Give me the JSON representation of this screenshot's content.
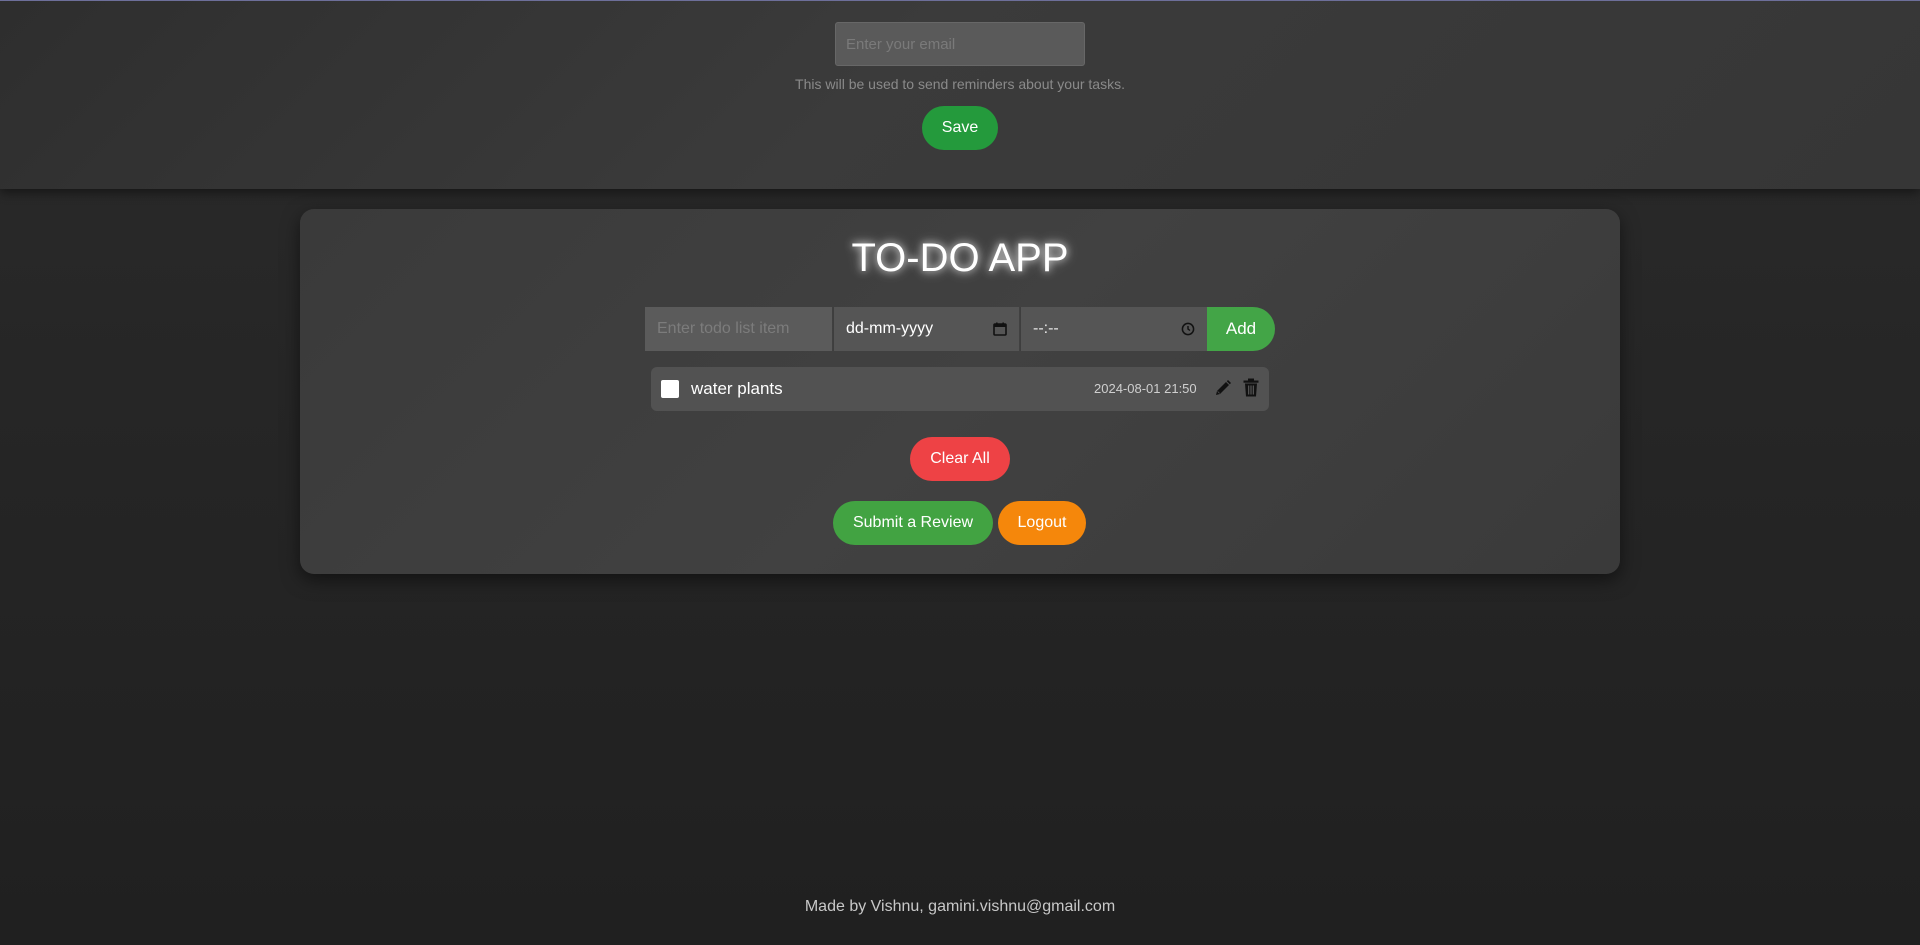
{
  "email_section": {
    "placeholder": "Enter your email",
    "hint": "This will be used to send reminders about your tasks.",
    "save_label": "Save"
  },
  "app": {
    "title": "TO-DO APP",
    "todo_placeholder": "Enter todo list item",
    "date_value": "dd-mm-yyyy",
    "time_value": "--:--",
    "add_label": "Add",
    "calendar_icon": "calendar-icon",
    "clock_icon": "clock-icon"
  },
  "todos": [
    {
      "text": "water plants",
      "datetime": "2024-08-01 21:50",
      "done": false,
      "edit_icon": "pencil-icon",
      "delete_icon": "trash-icon"
    }
  ],
  "actions": {
    "clear_all_label": "Clear All",
    "review_label": "Submit a Review",
    "logout_label": "Logout"
  },
  "footer": {
    "text": "Made by Vishnu, gamini.vishnu@gmail.com"
  },
  "colors": {
    "save": "#249a3c",
    "add": "#43a547",
    "clear_all": "#ee4245",
    "review": "#42a342",
    "logout": "#f5870b"
  }
}
